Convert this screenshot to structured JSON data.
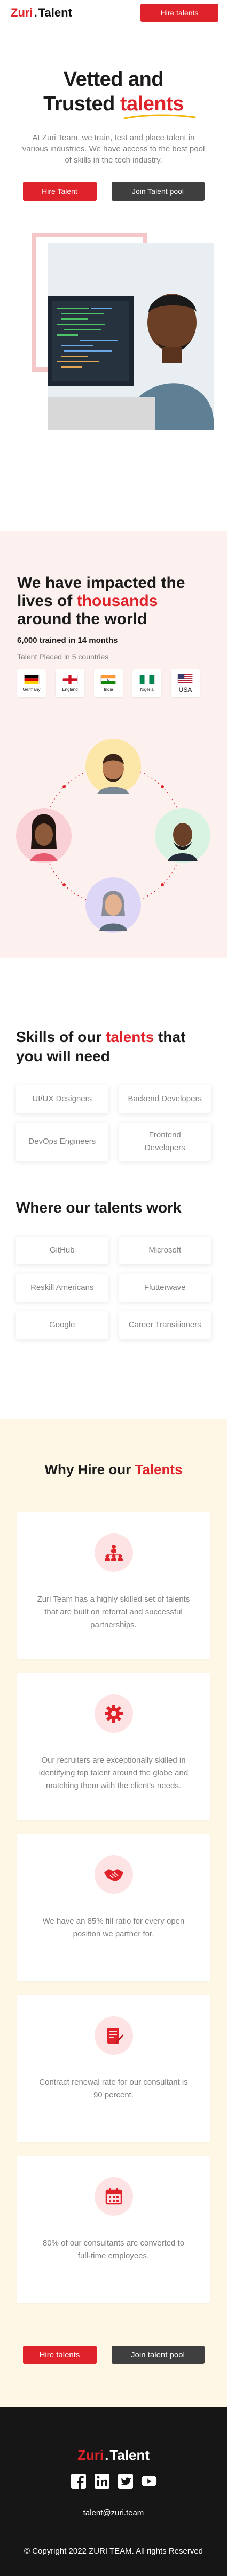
{
  "brand": {
    "zuri": "Zuri",
    "talent": "Talent"
  },
  "header": {
    "cta_label": "Hire talents"
  },
  "hero": {
    "title_line1": "Vetted and",
    "title_line2_prefix": "Trusted ",
    "title_line2_highlight": "talents",
    "description": "At Zuri Team, we train, test and place talent in various industries. We have access to the best pool of skills in the tech industry.",
    "primary_button": "Hire Talent",
    "secondary_button": "Join Talent pool"
  },
  "impact": {
    "title_prefix": "We have impacted the lives of ",
    "title_highlight": "thousands",
    "title_suffix": " around the world",
    "stat": "6,000 trained in 14 months",
    "sub": "Talent Placed in 5 countries",
    "flags": [
      {
        "label": "Germany",
        "icon": "germany-flag"
      },
      {
        "label": "England",
        "icon": "england-flag"
      },
      {
        "label": "India",
        "icon": "india-flag"
      },
      {
        "label": "Nigeria",
        "icon": "nigeria-flag"
      },
      {
        "label": "USA",
        "icon": "usa-flag"
      }
    ]
  },
  "skills": {
    "title_prefix": "Skills of our ",
    "title_highlight": "talents",
    "title_suffix": " that you will need",
    "items": [
      "UI/UX Designers",
      "Backend Developers",
      "DevOps Engineers",
      "Frontend Developers"
    ]
  },
  "where": {
    "title": "Where our talents work",
    "items": [
      "GitHub",
      "Microsoft",
      "Reskill Americans",
      "Flutterwave",
      "Google",
      "Career Transitioners"
    ]
  },
  "why": {
    "title_prefix": "Why Hire our ",
    "title_highlight": "Talents",
    "cards": [
      {
        "icon": "team-network-icon",
        "text": "Zuri Team has a highly skilled set of talents that are built on referral and successful partnerships."
      },
      {
        "icon": "gear-icon",
        "text": "Our recruiters are exceptionally skilled in identifying top talent around the globe and matching them with the client's needs."
      },
      {
        "icon": "handshake-icon",
        "text": "We have an 85% fill ratio for every open position we partner for."
      },
      {
        "icon": "contract-icon",
        "text": "Contract renewal rate for our consultant is 90 percent."
      },
      {
        "icon": "calendar-icon",
        "text": "80% of our consultants are converted to full-time employees."
      }
    ],
    "primary_button": "Hire talents",
    "secondary_button": "Join talent pool"
  },
  "footer": {
    "email": "talent@zuri.team",
    "copyright": "© Copyright 2022 ZURI TEAM. All rights Reserved",
    "socials": [
      "facebook-icon",
      "linkedin-icon",
      "twitter-icon",
      "youtube-icon"
    ]
  },
  "colors": {
    "accent": "#e0232a",
    "hero_pink": "#fdf1ef",
    "why_cream": "#fef7e6",
    "footer": "#161616"
  }
}
